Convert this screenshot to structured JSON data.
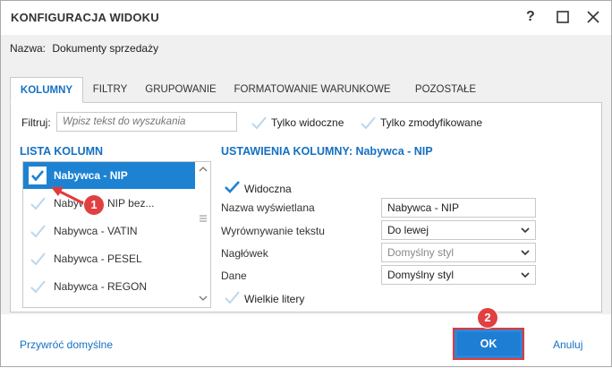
{
  "window": {
    "title": "KONFIGURACJA WIDOKU",
    "help_label": "?",
    "maximize_icon": "square-icon",
    "close_icon": "close-icon"
  },
  "name_field": {
    "label": "Nazwa:",
    "value": "Dokumenty sprzedaży"
  },
  "tabs": [
    {
      "label": "KOLUMNY",
      "active": true
    },
    {
      "label": "FILTRY",
      "active": false
    },
    {
      "label": "GRUPOWANIE",
      "active": false
    },
    {
      "label": "FORMATOWANIE WARUNKOWE",
      "active": false
    },
    {
      "label": "POZOSTAŁE",
      "active": false
    }
  ],
  "filter": {
    "label": "Filtruj:",
    "placeholder": "Wpisz tekst do wyszukania",
    "only_visible_label": "Tylko widoczne",
    "only_modified_label": "Tylko zmodyfikowane"
  },
  "column_list": {
    "title": "LISTA KOLUMN",
    "items": [
      {
        "label": "Nabywca - NIP",
        "checked": true,
        "selected": true
      },
      {
        "label": "Nabywca - NIP bez...",
        "checked": false,
        "selected": false
      },
      {
        "label": "Nabywca - VATIN",
        "checked": false,
        "selected": false
      },
      {
        "label": "Nabywca - PESEL",
        "checked": false,
        "selected": false
      },
      {
        "label": "Nabywca - REGON",
        "checked": false,
        "selected": false
      }
    ]
  },
  "column_settings": {
    "title": "USTAWIENIA KOLUMNY: Nabywca - NIP",
    "visible_label": "Widoczna",
    "visible_checked": true,
    "display_name_label": "Nazwa wyświetlana",
    "display_name_value": "Nabywca - NIP",
    "text_align_label": "Wyrównywanie tekstu",
    "text_align_value": "Do lewej",
    "header_label": "Nagłówek",
    "header_value": "Domyślny styl",
    "data_label": "Dane",
    "data_value": "Domyślny styl",
    "uppercase_label": "Wielkie litery",
    "uppercase_checked": false
  },
  "footer": {
    "restore_label": "Przywróć domyślne",
    "ok_label": "OK",
    "cancel_label": "Anuluj"
  },
  "annotations": {
    "badge_1": "1",
    "badge_2": "2"
  },
  "colors": {
    "accent": "#1570c1",
    "selection": "#1e82d2",
    "annotation_red": "#e03a3a"
  }
}
